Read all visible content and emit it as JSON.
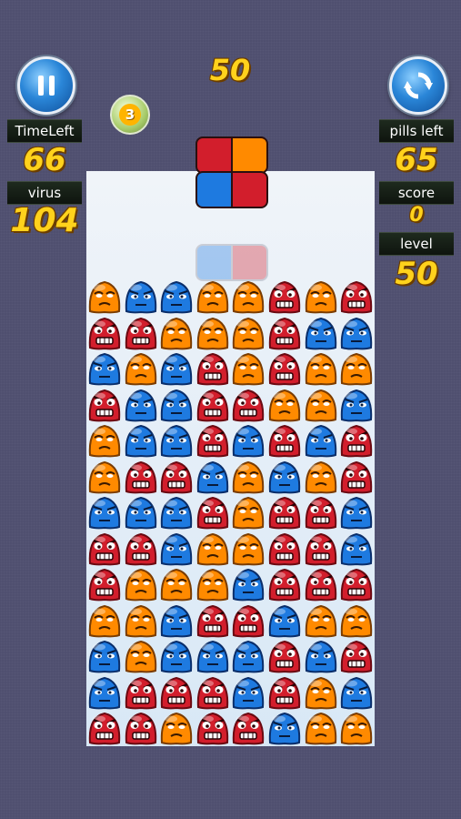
{
  "header": {
    "points": "50"
  },
  "left_panel": {
    "timeleft_label": "TimeLeft",
    "timeleft_value": "66",
    "virus_label": "virus",
    "virus_value": "104"
  },
  "right_panel": {
    "pills_left_label": "pills left",
    "pills_left_value": "65",
    "score_label": "score",
    "score_value": "0",
    "level_label": "level",
    "level_value": "50"
  },
  "timer_badge": "3",
  "colors": {
    "red": "#d21e2c",
    "orange": "#ff8a00",
    "blue": "#1e7ae0",
    "yellow_text": "#ffd21c"
  },
  "next_pill_top": [
    "red",
    "orange"
  ],
  "next_pill_bottom": [
    "blue",
    "red"
  ],
  "ghost_pill": [
    "blue",
    "red"
  ],
  "viruses": [
    [
      "orange",
      "blue",
      "blue",
      "orange",
      "orange",
      "red",
      "orange",
      "red"
    ],
    [
      "red",
      "red",
      "orange",
      "orange",
      "orange",
      "red",
      "blue",
      "blue"
    ],
    [
      "blue",
      "orange",
      "blue",
      "red",
      "orange",
      "red",
      "orange",
      "orange"
    ],
    [
      "red",
      "blue",
      "blue",
      "red",
      "red",
      "orange",
      "orange",
      "blue"
    ],
    [
      "orange",
      "blue",
      "blue",
      "red",
      "blue",
      "red",
      "blue",
      "red"
    ],
    [
      "orange",
      "red",
      "red",
      "blue",
      "orange",
      "blue",
      "orange",
      "red"
    ],
    [
      "blue",
      "blue",
      "blue",
      "red",
      "orange",
      "red",
      "red",
      "blue"
    ],
    [
      "red",
      "red",
      "blue",
      "orange",
      "orange",
      "red",
      "red",
      "blue"
    ],
    [
      "red",
      "orange",
      "orange",
      "orange",
      "blue",
      "red",
      "red",
      "red"
    ],
    [
      "orange",
      "orange",
      "blue",
      "red",
      "red",
      "blue",
      "orange",
      "orange"
    ],
    [
      "blue",
      "orange",
      "blue",
      "blue",
      "blue",
      "red",
      "blue",
      "red"
    ],
    [
      "blue",
      "red",
      "red",
      "red",
      "blue",
      "red",
      "orange",
      "blue"
    ],
    [
      "red",
      "red",
      "orange",
      "red",
      "red",
      "blue",
      "orange",
      "orange"
    ]
  ]
}
